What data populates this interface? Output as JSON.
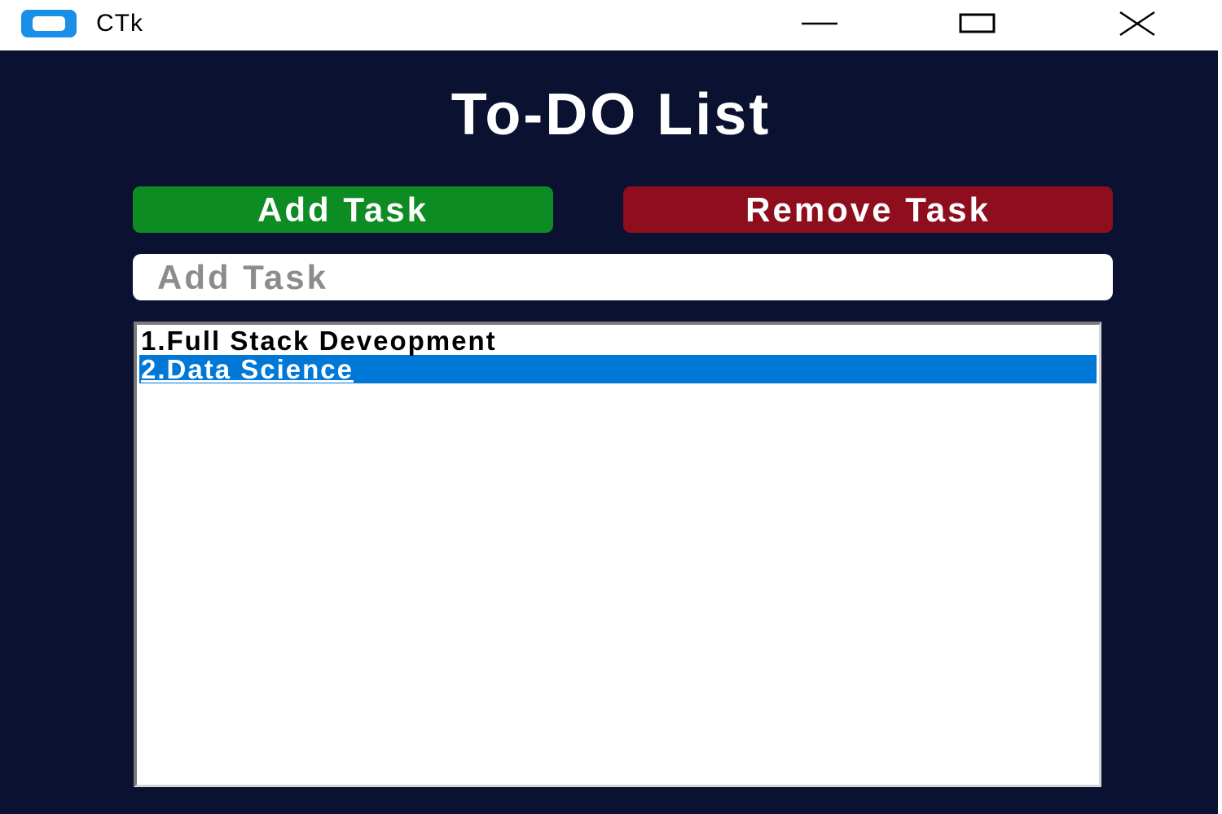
{
  "window": {
    "title": "CTk",
    "icon": "ctk-app-icon",
    "controls": [
      "minimize-icon",
      "maximize-icon",
      "close-icon"
    ]
  },
  "app": {
    "heading": "To-DO List",
    "add_button_label": "Add Task",
    "remove_button_label": "Remove Task",
    "input": {
      "placeholder": "Add Task",
      "value": ""
    },
    "tasks": [
      {
        "label": "1.Full  Stack  Deveopment",
        "selected": false
      },
      {
        "label": "2.Data  Science",
        "selected": true
      }
    ]
  },
  "colors": {
    "background": "#0b1130",
    "add_button": "#0c8c22",
    "remove_button": "#8e0e1e",
    "selection": "#0078d7"
  }
}
